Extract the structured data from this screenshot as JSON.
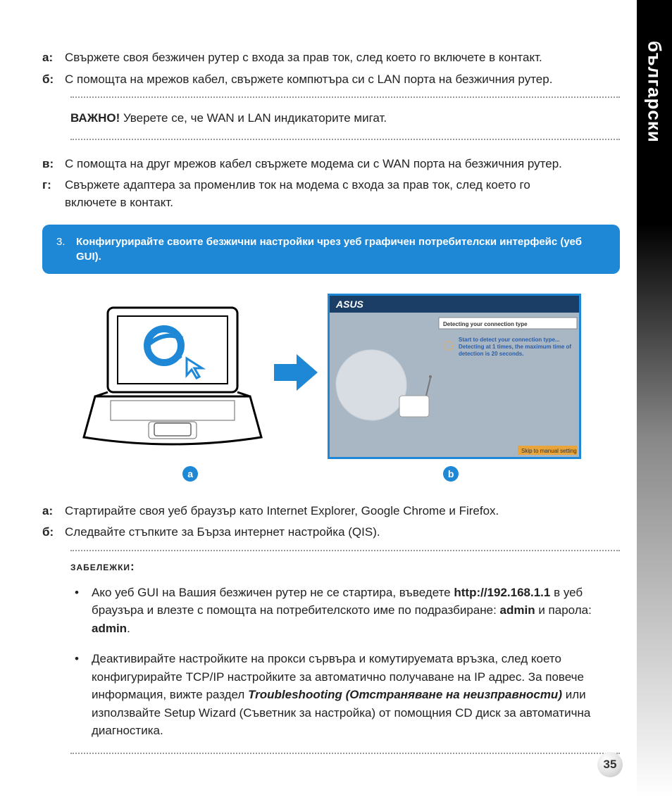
{
  "sideTab": {
    "label": "български"
  },
  "topList": [
    {
      "label": "а:",
      "text": "Свържете своя безжичен рутер с входа за прав ток, след което го включете в контакт."
    },
    {
      "label": "б:",
      "text": "С помощта на мрежов кабел, свържете компютъра си с LAN порта на безжичния рутер."
    }
  ],
  "important": {
    "label": "ВАЖНО!",
    "text": " Уверете се, че WAN и LAN индикаторите мигат."
  },
  "midList": [
    {
      "label": "в:",
      "text": "С помощта на друг мрежов кабел свържете модема си с WAN порта на безжичния рутер."
    },
    {
      "label": "г:",
      "text_line1": "Свържете адаптера за променлив ток на модема с входа за прав ток, след което го",
      "text_line2": "включете в контакт."
    }
  ],
  "stepBox": {
    "num": "3.",
    "text": "Конфигурирайте своите безжични настройки чрез уеб графичен потребителски интерфейс (уеб GUI)."
  },
  "gui": {
    "brand": "ASUS",
    "panelTitle": "Detecting your connection type",
    "line1": "Start to detect your connection type...",
    "line2": "Detecting at 1 times, the maximum time of",
    "line3": "detection is 20 seconds.",
    "skip": "Skip to manual setting"
  },
  "badges": {
    "a": "a",
    "b": "b"
  },
  "bottomList": [
    {
      "label": "а:",
      "text": "Стартирайте своя уеб браузър като Internet Explorer, Google Chrome и Firefox."
    },
    {
      "label": "б:",
      "text": "Следвайте стъпките за Бърза интернет настройка (QIS)."
    }
  ],
  "notesHeading": "ЗАБЕЛЕЖКИ",
  "notes": [
    {
      "pre": "Ако уеб GUI на Вашия безжичен рутер не се стартира, въведете ",
      "b1": "http://192.168.1.1",
      "mid": " в уеб браузъра и влезте с помощта на потребителското име по подразбиране: ",
      "b2": "admin",
      "mid2": " и парола: ",
      "b3": "admin",
      "post": "."
    },
    {
      "pre": "Деактивирайте настройките на прокси сървъра и комутируемата връзка, след което конфигурирайте TCP/IP настройките за автоматично получаване на IP адрес. За повече информация, вижте раздел ",
      "bi": "Troubleshooting (Отстраняване на неизправности)",
      "post": " или използвайте Setup Wizard (Съветник за настройка) от помощния CD диск за автоматична диагностика."
    }
  ],
  "pageNumber": "35"
}
